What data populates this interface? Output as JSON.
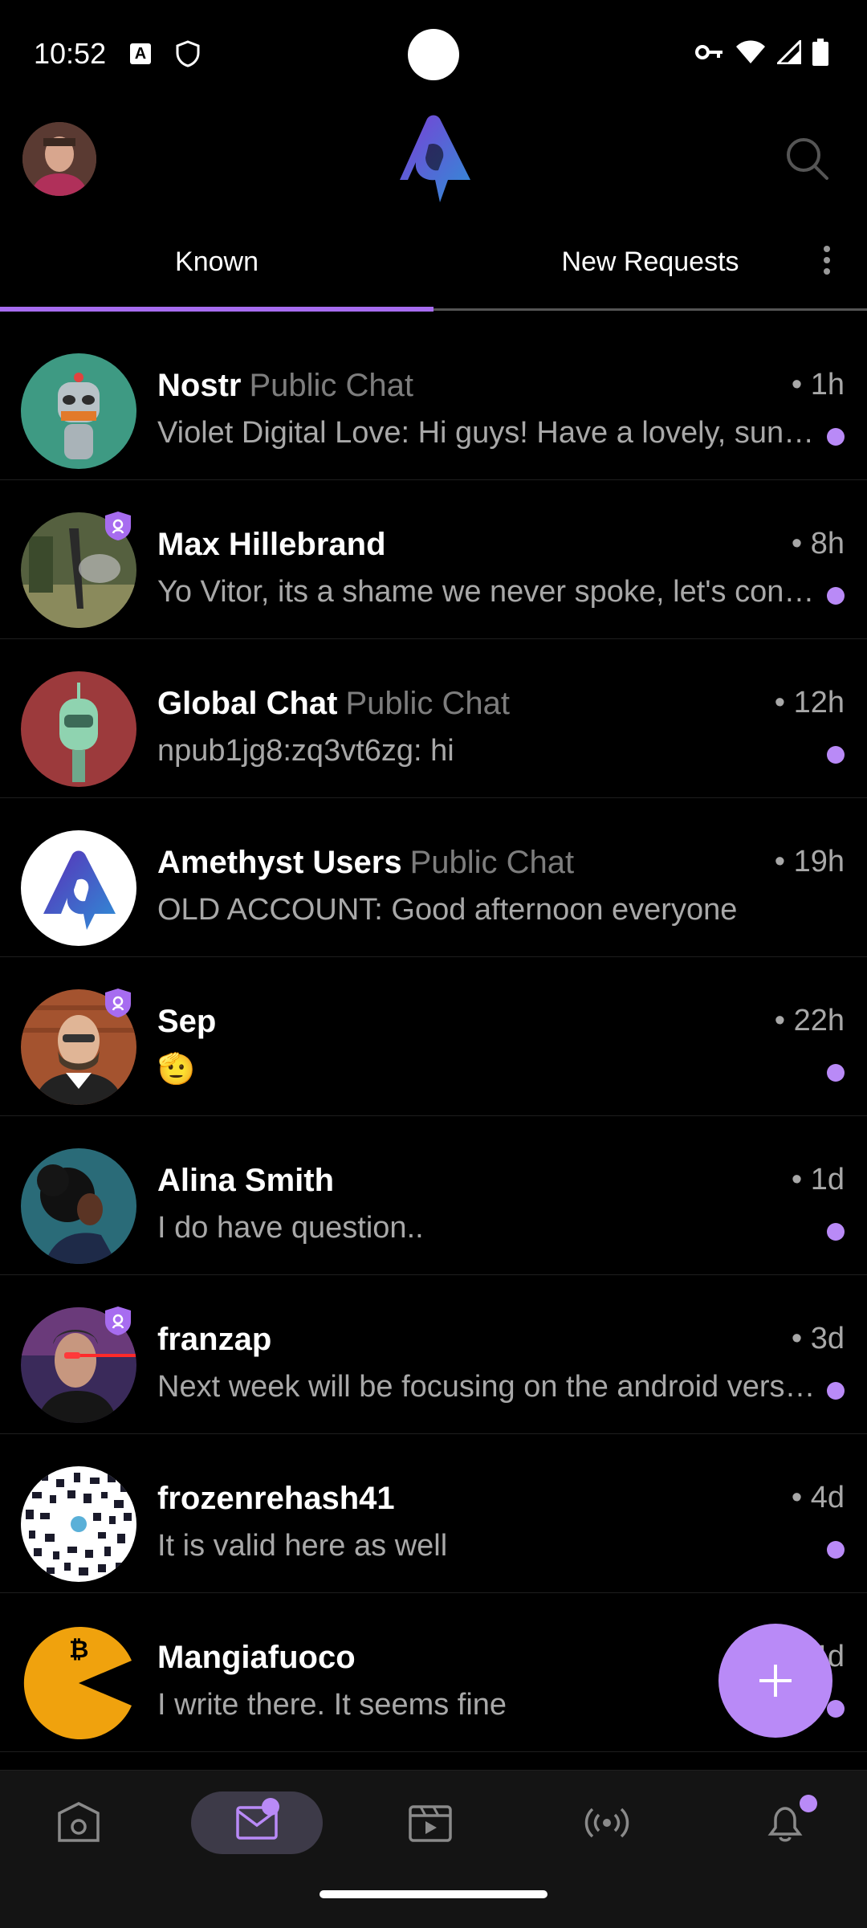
{
  "status_bar": {
    "time": "10:52",
    "icons": [
      "a-icon",
      "shield-icon",
      "key-icon",
      "wifi-icon",
      "signal-icon",
      "battery-icon"
    ]
  },
  "header": {
    "logo": "amethyst-logo",
    "search_icon": "search-icon"
  },
  "tabs": [
    {
      "label": "Known",
      "selected": true
    },
    {
      "label": "New Requests",
      "selected": false
    }
  ],
  "colors": {
    "accent": "#a76cf0",
    "unread": "#b98af7",
    "background": "#000000"
  },
  "chats": [
    {
      "name": "Nostr",
      "subtitle": "Public Chat",
      "time": "• 1h",
      "message": "Violet Digital Love: Hi guys! Have a lovely, sunny day!",
      "unread": true,
      "verified": false
    },
    {
      "name": "Max Hillebrand",
      "subtitle": "",
      "time": "• 8h",
      "message": "Yo Vitor, its a shame we never spoke, let's connect soon",
      "unread": true,
      "verified": true
    },
    {
      "name": "Global Chat",
      "subtitle": "Public Chat",
      "time": "• 12h",
      "message": "npub1jg8:zq3vt6zg: hi",
      "unread": true,
      "verified": false
    },
    {
      "name": "Amethyst Users",
      "subtitle": "Public Chat",
      "time": "• 19h",
      "message": "OLD ACCOUNT: Good afternoon everyone",
      "unread": false,
      "verified": false
    },
    {
      "name": "Sep",
      "subtitle": "",
      "time": "• 22h",
      "message": "🫡",
      "unread": true,
      "verified": true
    },
    {
      "name": "Alina Smith",
      "subtitle": "",
      "time": "• 1d",
      "message": "I do have question..",
      "unread": true,
      "verified": false
    },
    {
      "name": "franzap",
      "subtitle": "",
      "time": "• 3d",
      "message": "Next week will be focusing on the android version",
      "unread": true,
      "verified": true
    },
    {
      "name": "frozenrehash41",
      "subtitle": "",
      "time": "• 4d",
      "message": "It is valid here as well",
      "unread": true,
      "verified": false
    },
    {
      "name": "Mangiafuoco",
      "subtitle": "",
      "time": "• 4d",
      "message": "I write there. It seems fine",
      "unread": true,
      "verified": false
    }
  ],
  "fab": {
    "icon": "plus-icon"
  },
  "bottom_nav": [
    {
      "icon": "home-icon",
      "selected": false
    },
    {
      "icon": "messages-icon",
      "selected": true,
      "dot": true
    },
    {
      "icon": "video-icon",
      "selected": false
    },
    {
      "icon": "broadcast-icon",
      "selected": false
    },
    {
      "icon": "bell-icon",
      "selected": false,
      "dot": true
    }
  ]
}
